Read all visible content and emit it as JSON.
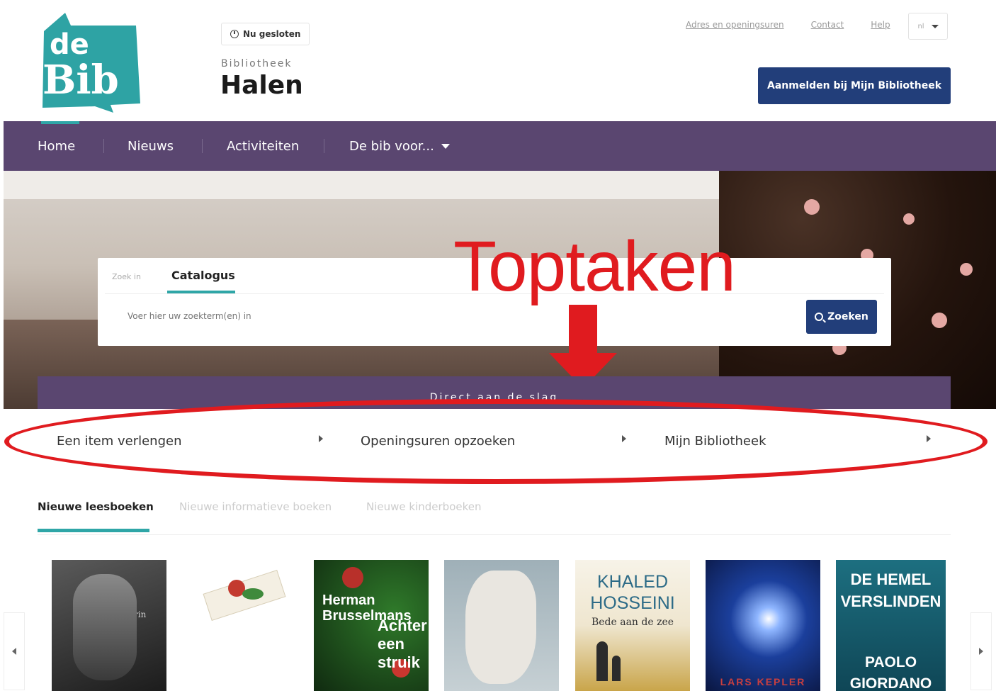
{
  "header": {
    "logo_text_top": "de",
    "logo_text_bottom": "Bib",
    "status": "Nu gesloten",
    "library_label": "Bibliotheek",
    "library_name": "Halen",
    "links": [
      "Adres en openingsuren",
      "Contact",
      "Help"
    ],
    "language": "nl",
    "login_button": "Aanmelden bij Mijn Bibliotheek"
  },
  "nav": {
    "items": [
      "Home",
      "Nieuws",
      "Activiteiten",
      "De bib voor..."
    ],
    "active": "Home"
  },
  "search": {
    "tab_label_small": "Zoek in",
    "tab_active": "Catalogus",
    "placeholder": "Voer hier uw zoekterm(en) in",
    "button": "Zoeken"
  },
  "annotation": {
    "title": "Toptaken"
  },
  "quick_tasks": {
    "heading": "Direct aan de slag",
    "items": [
      "Een item verlengen",
      "Openingsuren opzoeken",
      "Mijn Bibliotheek"
    ]
  },
  "book_tabs": {
    "items": [
      "Nieuwe leesboeken",
      "Nieuwe informatieve boeken",
      "Nieuwe kinderboeken"
    ],
    "active": "Nieuwe leesboeken"
  },
  "books": [
    {
      "author": "Peter Terrin"
    },
    {
      "author": ""
    },
    {
      "author": "Herman Brusselmans",
      "title": "Achter een struik"
    },
    {
      "author": ""
    },
    {
      "author": "KHALED HOSSEINI",
      "title": "Bede aan de zee"
    },
    {
      "author": "LARS KEPLER"
    },
    {
      "title": "DE HEMEL VERSLINDEN",
      "author": "PAOLO GIORDANO"
    }
  ],
  "colors": {
    "teal": "#2fa6a7",
    "purple": "#5a4670",
    "navy": "#223e7a",
    "annotation_red": "#e01b1f"
  }
}
